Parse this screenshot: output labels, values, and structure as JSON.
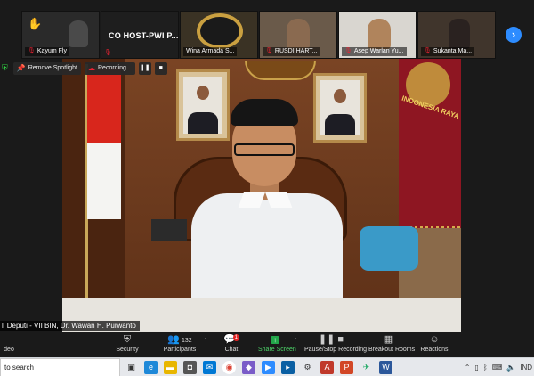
{
  "participants": [
    {
      "name": "Kayum Fly",
      "hand_raised": true
    },
    {
      "name": "CO HOST-PWI P...",
      "co_host_tile": true
    },
    {
      "name": "Wina Armada S..."
    },
    {
      "name": "RUSDI HART..."
    },
    {
      "name": "Asep Warlan Yu..."
    },
    {
      "name": "Sukanta Ma..."
    }
  ],
  "spotlight": {
    "remove_label": "Remove Spotlight",
    "recording_label": "Recording...",
    "pause_icon": "pause-icon",
    "stop_icon": "stop-icon"
  },
  "main_video": {
    "banner_text": "INDONESIA RAYA",
    "speaker_label": "ll Deputi - VII BIN, Dr. Wawan H. Purwanto"
  },
  "toolbar": {
    "video_label": "deo",
    "security_label": "Security",
    "participants_label": "Participants",
    "participants_count": "132",
    "chat_label": "Chat",
    "chat_badge": "1",
    "share_label": "Share Screen",
    "record_label": "Pause/Stop Recording",
    "breakout_label": "Breakout Rooms",
    "reactions_label": "Reactions"
  },
  "taskbar": {
    "search_placeholder": "to search",
    "language": "IND"
  },
  "colors": {
    "zoom_bg": "#1a1a1a",
    "share_green": "#23a64a",
    "accent_blue": "#2d8cff"
  }
}
